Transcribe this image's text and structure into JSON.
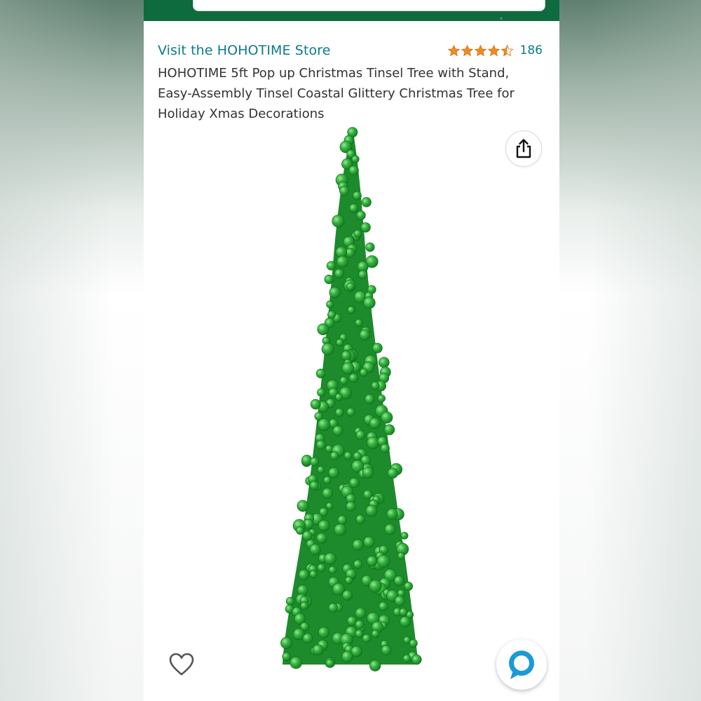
{
  "store": {
    "link_label": "Visit the HOHOTIME Store"
  },
  "rating": {
    "stars": 4.5,
    "count": "186",
    "star_color": "#f08a24"
  },
  "product": {
    "title": "HOHOTIME 5ft Pop up Christmas Tinsel Tree with Stand, Easy-Assembly Tinsel Coastal Glittery Christmas Tree for Holiday Xmas Decorations",
    "image_icon": "green-tinsel-christmas-tree"
  },
  "colors": {
    "header_bg": "#0d6b3e",
    "link": "#0e7a8c",
    "text": "#333333",
    "alexa_ring": "#1a9ad6",
    "tree_green": "#2fa83a"
  },
  "icons": {
    "share": "share-icon",
    "wishlist": "heart-icon",
    "alexa": "alexa-icon"
  }
}
